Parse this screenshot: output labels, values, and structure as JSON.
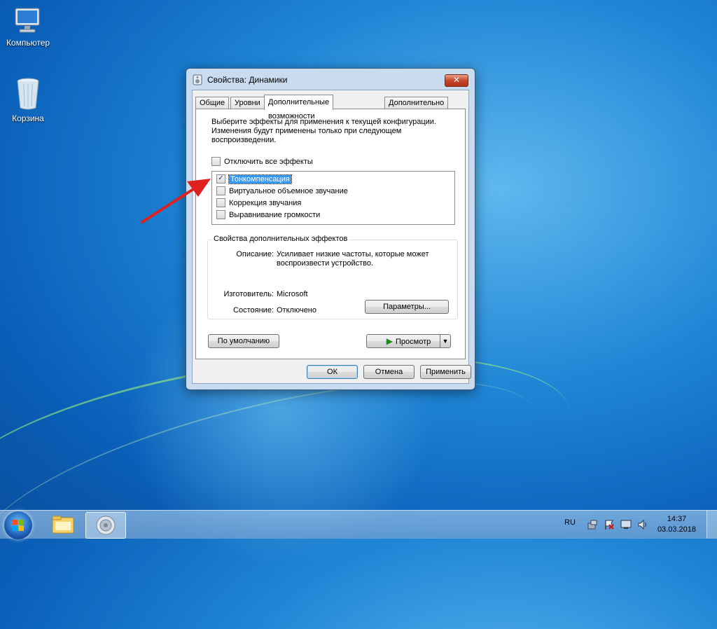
{
  "desktop": {
    "icons": [
      {
        "label": "Компьютер",
        "icon": "computer-icon"
      },
      {
        "label": "Корзина",
        "icon": "recycle-bin-icon"
      }
    ]
  },
  "window": {
    "title": "Свойства: Динамики",
    "close": "✕",
    "tabs": [
      "Общие",
      "Уровни",
      "Дополнительные возможности",
      "Дополнительно"
    ],
    "active_tab": 2,
    "intro": "Выберите эффекты для применения к текущей конфигурации. Изменения будут применены только при следующем воспроизведении.",
    "disable_all": {
      "label": "Отключить все эффекты",
      "checked": false
    },
    "effects": [
      {
        "label": "Тонкомпенсация",
        "checked": true,
        "selected": true
      },
      {
        "label": "Виртуальное объемное звучание",
        "checked": false
      },
      {
        "label": "Коррекция звучания",
        "checked": false
      },
      {
        "label": "Выравнивание громкости",
        "checked": false
      }
    ],
    "properties": {
      "title": "Свойства дополнительных эффектов",
      "description_label": "Описание:",
      "description": "Усиливает низкие частоты, которые может воспроизвести устройство.",
      "vendor_label": "Изготовитель:",
      "vendor": "Microsoft",
      "state_label": "Состояние:",
      "state": "Отключено",
      "settings_button": "Параметры..."
    },
    "default_button": "По умолчанию",
    "preview_button": "Просмотр",
    "ok_button": "ОК",
    "cancel_button": "Отмена",
    "apply_button": "Применить"
  },
  "taskbar": {
    "language": "RU",
    "time": "14:37",
    "date": "03.03.2018"
  },
  "colors": {
    "selection": "#3399ff",
    "arrow": "#e0201c"
  }
}
